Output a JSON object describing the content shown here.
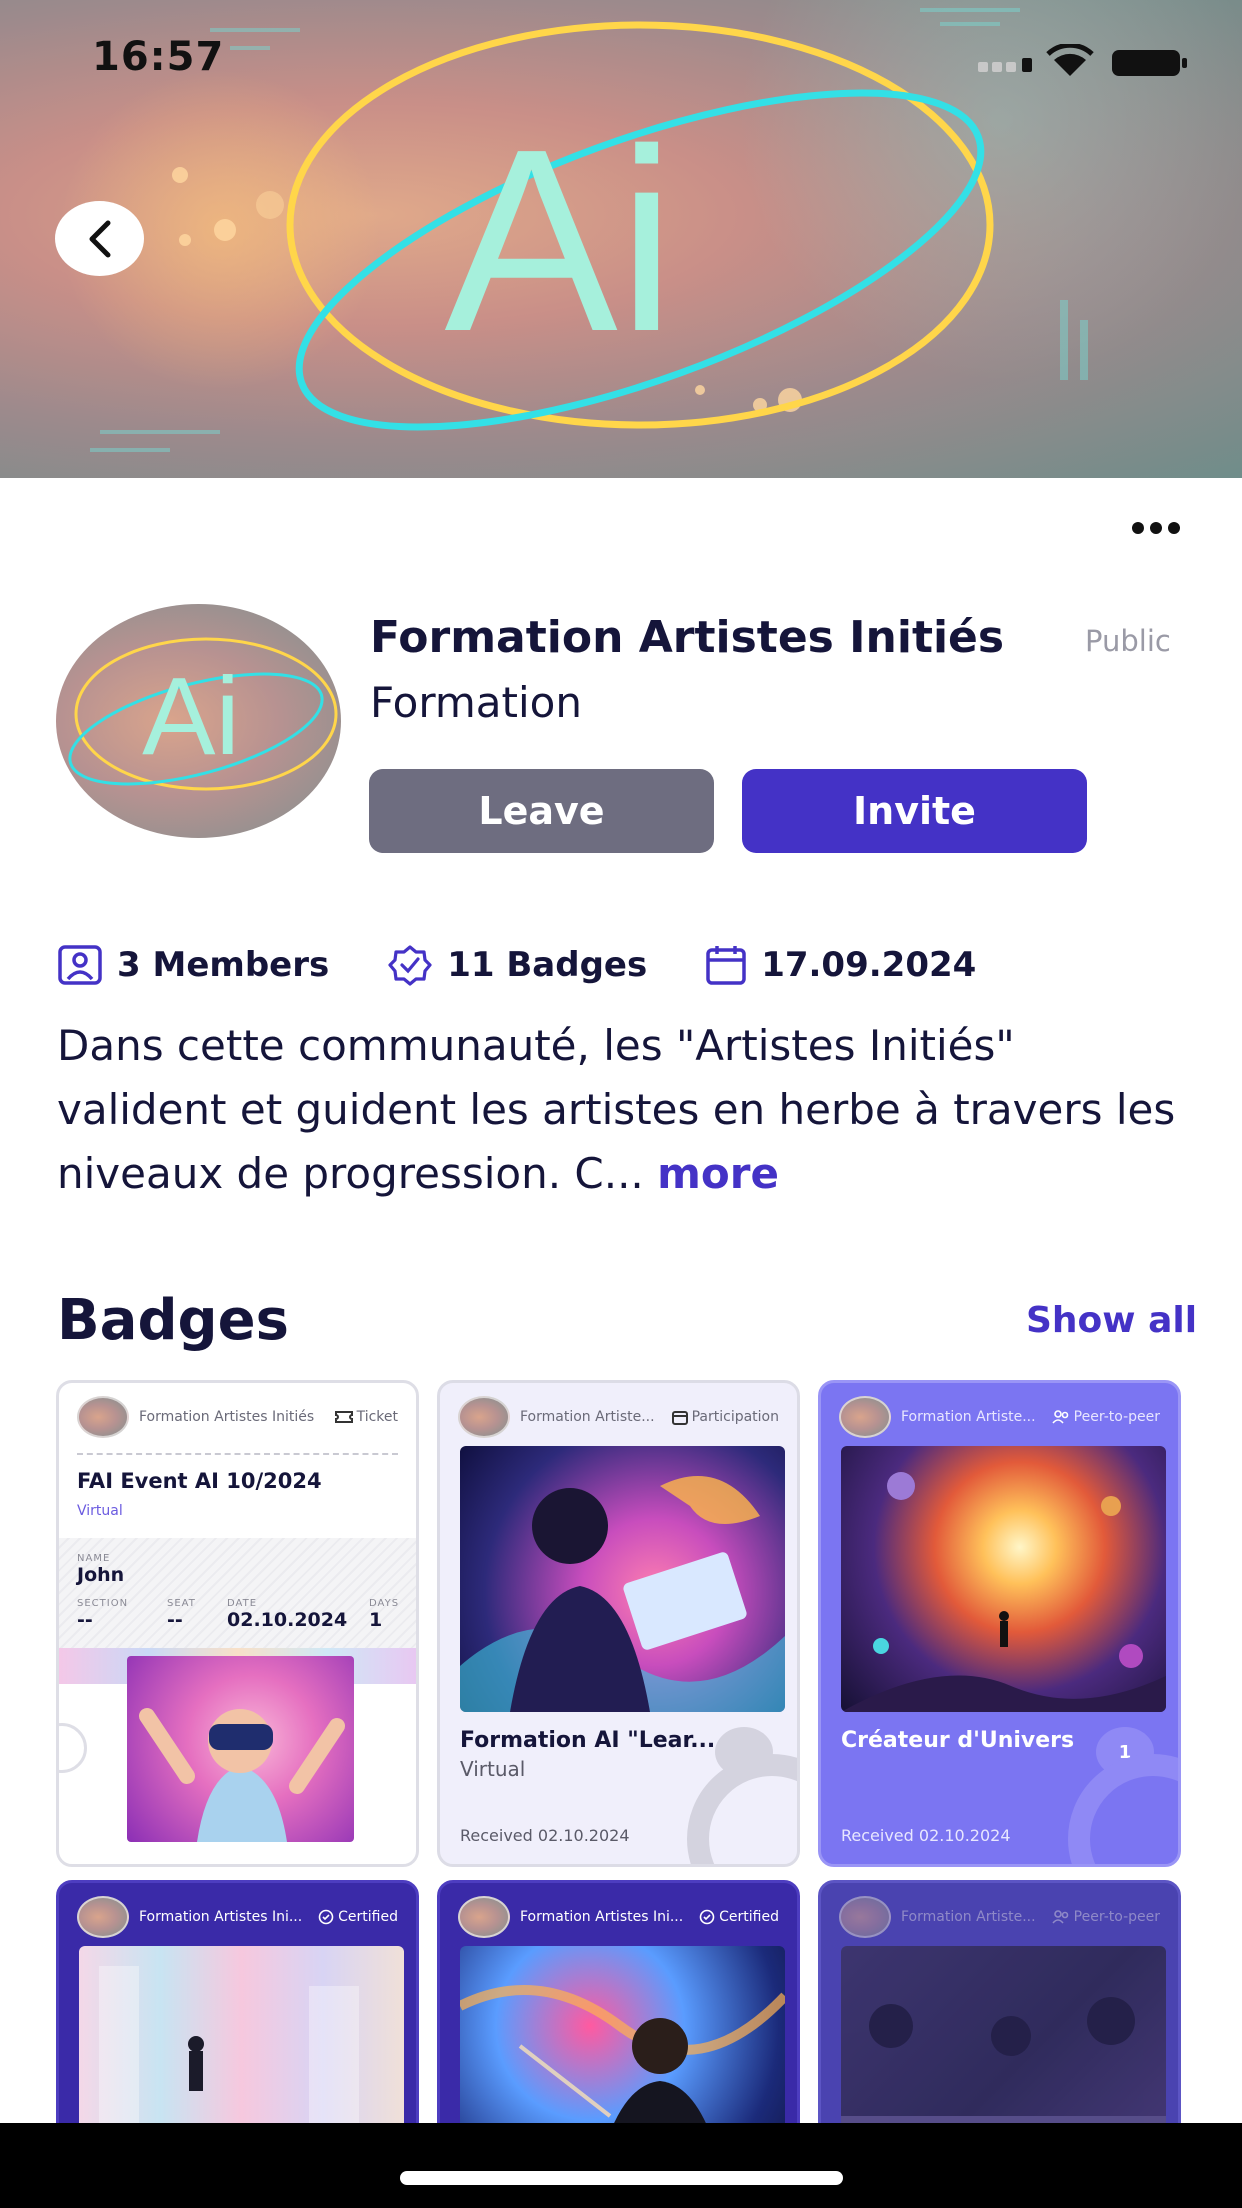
{
  "status_bar": {
    "time": "16:57"
  },
  "hero": {
    "logo_text": "Ai"
  },
  "community": {
    "name": "Formation Artistes Initiés",
    "visibility": "Public",
    "category": "Formation",
    "leave_label": "Leave",
    "invite_label": "Invite",
    "members": "3 Members",
    "badges_count": "11 Badges",
    "date": "17.09.2024",
    "description": "Dans cette communauté, les \"Artistes Initiés\" valident et guident les artistes en herbe à travers les niveaux de progression. C...",
    "more_label": "more"
  },
  "badges_section": {
    "title": "Badges",
    "show_all": "Show all",
    "cards": [
      {
        "org": "Formation Artistes Initiés",
        "type": "Ticket",
        "event": "FAI Event AI 10/2024",
        "mode": "Virtual",
        "name_label": "NAME",
        "name_value": "John",
        "section_label": "SECTION",
        "section_value": "--",
        "seat_label": "SEAT",
        "seat_value": "--",
        "date_label": "DATE",
        "date_value": "02.10.2024",
        "days_label": "DAYS",
        "days_value": "1"
      },
      {
        "org": "Formation Artiste...",
        "type": "Participation",
        "name": "Formation AI \"Lear...",
        "sub": "Virtual",
        "received": "Received 02.10.2024"
      },
      {
        "org": "Formation Artiste...",
        "type": "Peer-to-peer",
        "name": "Créateur d'Univers",
        "count": "1",
        "received": "Received 02.10.2024"
      },
      {
        "org": "Formation Artistes Ini...",
        "type": "Certified"
      },
      {
        "org": "Formation Artistes Ini...",
        "type": "Certified"
      },
      {
        "org": "Formation Artiste...",
        "type": "Peer-to-peer"
      }
    ]
  },
  "colors": {
    "accent": "#4432c6",
    "leave_button": "#6e6d80",
    "peer_card": "#7b75f2",
    "certified_card": "#3a2aa8",
    "text": "#15153a"
  }
}
